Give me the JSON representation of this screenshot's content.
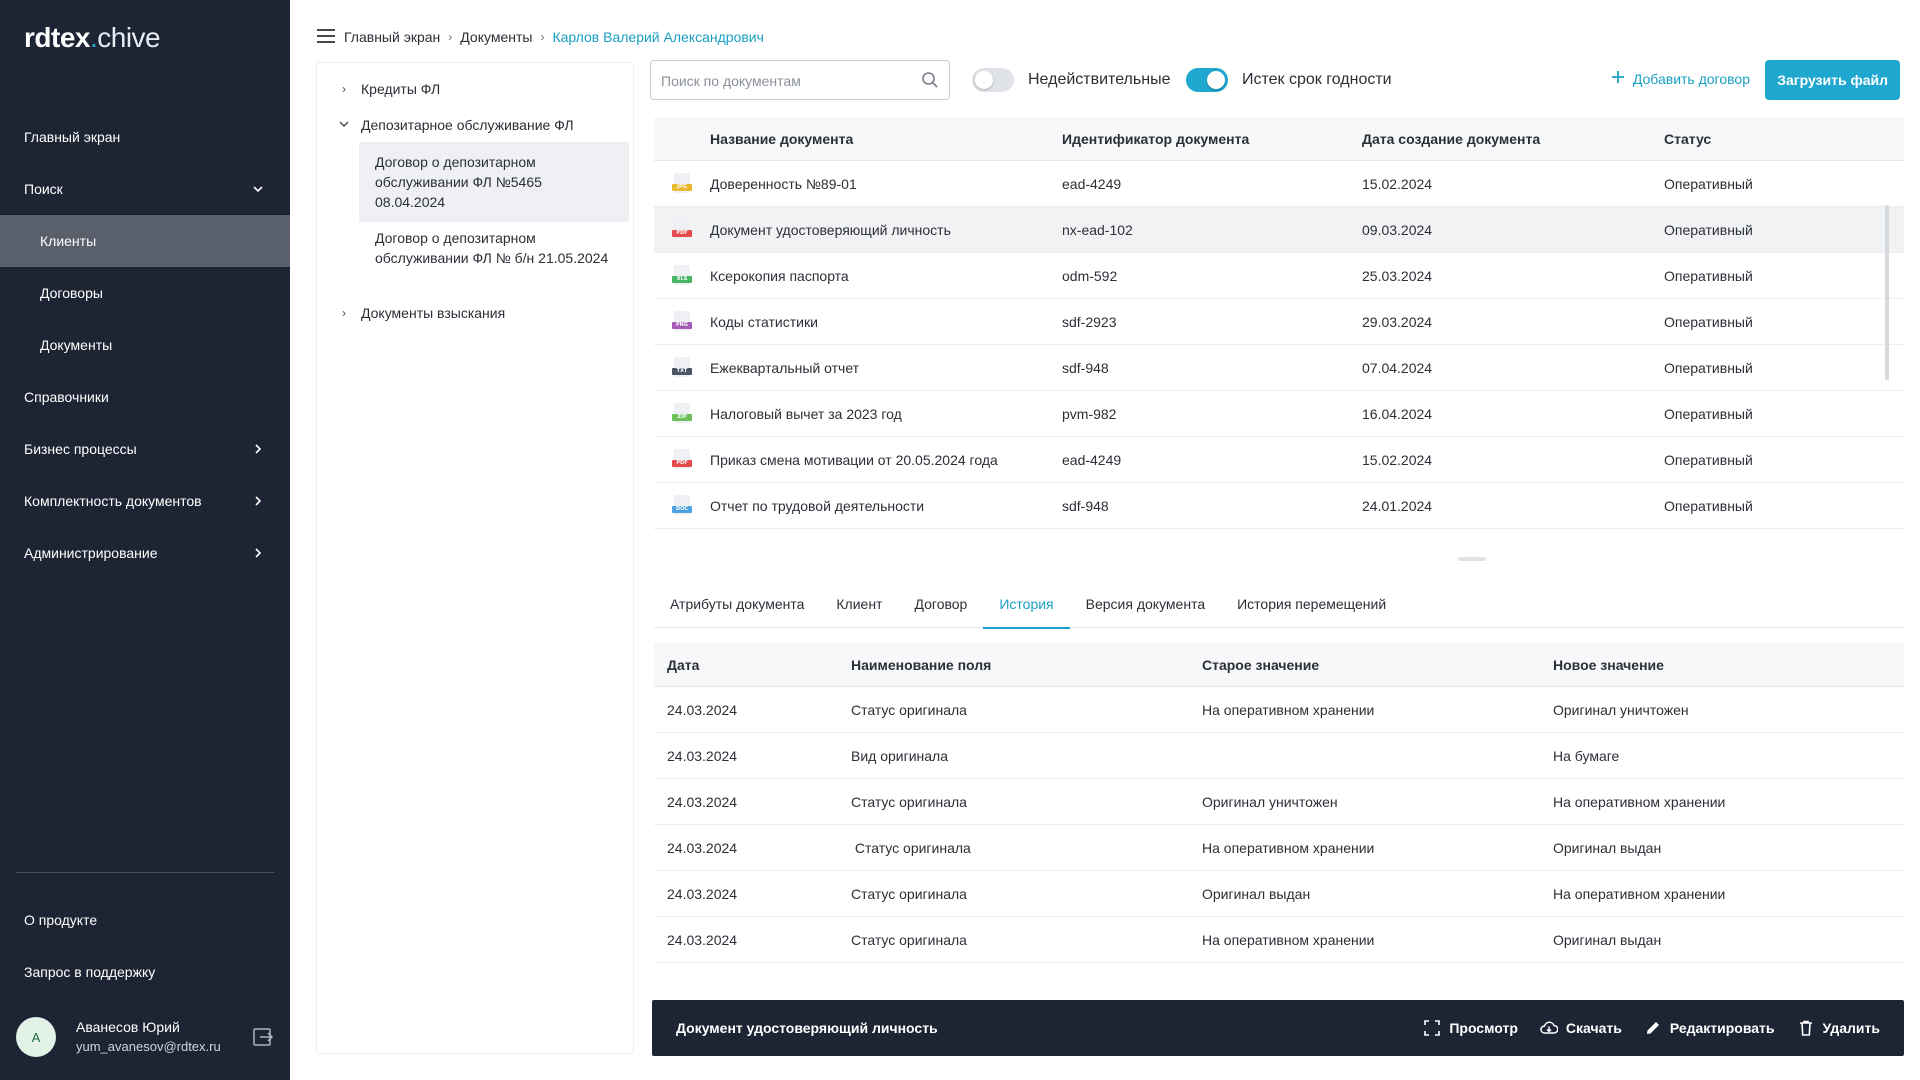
{
  "app": {
    "logo_bold": "rdtex",
    "logo_dot": ".",
    "logo_light": "chive"
  },
  "sidebar": {
    "items": [
      {
        "label": "Главный экран"
      },
      {
        "label": "Поиск"
      },
      {
        "label": "Клиенты"
      },
      {
        "label": "Договоры"
      },
      {
        "label": "Документы"
      },
      {
        "label": "Справочники"
      },
      {
        "label": "Бизнес процессы"
      },
      {
        "label": "Комплектность документов"
      },
      {
        "label": "Администрирование"
      }
    ],
    "bottom": [
      {
        "label": "О продукте"
      },
      {
        "label": "Запрос в поддержку"
      }
    ],
    "user": {
      "initial": "А",
      "name": "Аванесов Юрий",
      "email": "yum_avanesov@rdtex.ru"
    }
  },
  "breadcrumb": [
    "Главный экран",
    "Документы",
    "Карлов Валерий Александрович"
  ],
  "tree": {
    "groups": [
      {
        "label": "Кредиты ФЛ"
      },
      {
        "label": "Депозитарное обслуживание ФЛ"
      },
      {
        "label": "Документы взыскания"
      }
    ],
    "leaves": [
      {
        "label": "Договор о депозитарном обслуживании ФЛ №5465 08.04.2024"
      },
      {
        "label": "Договор о депозитарном обслуживании ФЛ № б/н 21.05.2024"
      }
    ]
  },
  "toolbar": {
    "search_placeholder": "Поиск по документам",
    "toggle_invalid": "Недействительные",
    "toggle_expired": "Истек срок годности",
    "add_contract": "Добавить договор",
    "upload_file": "Загрузить файл"
  },
  "documents": {
    "columns": [
      "Название документа",
      "Идентификатор документа",
      "Дата создание документа",
      "Статус"
    ],
    "rows": [
      {
        "type": "JPG",
        "color": "#e7b92e",
        "name": "Доверенность №89-01",
        "id": "ead-4249",
        "date": "15.02.2024",
        "status": "Оперативный"
      },
      {
        "type": "PDF",
        "color": "#e54b4b",
        "name": "Документ удостоверяющий личность",
        "id": "nx-ead-102",
        "date": "09.03.2024",
        "status": "Оперативный"
      },
      {
        "type": "XLS",
        "color": "#48b563",
        "name": "Ксерокопия паспорта",
        "id": "odm-592",
        "date": "25.03.2024",
        "status": "Оперативный"
      },
      {
        "type": "PNG",
        "color": "#a35bb5",
        "name": "Коды статистики",
        "id": "sdf-2923",
        "date": "29.03.2024",
        "status": "Оперативный"
      },
      {
        "type": "TXT",
        "color": "#4b5566",
        "name": "Ежеквартальный отчет",
        "id": "sdf-948",
        "date": "07.04.2024",
        "status": "Оперативный"
      },
      {
        "type": "ZIP",
        "color": "#6cc15a",
        "name": "Налоговый вычет за 2023 год",
        "id": "pvm-982",
        "date": "16.04.2024",
        "status": "Оперативный"
      },
      {
        "type": "PDF",
        "color": "#e54b4b",
        "name": "Приказ смена мотивации от 20.05.2024 года",
        "id": "ead-4249",
        "date": "15.02.2024",
        "status": "Оперативный"
      },
      {
        "type": "DOC",
        "color": "#4aa3e0",
        "name": "Отчет по трудовой деятельности",
        "id": "sdf-948",
        "date": "24.01.2024",
        "status": "Оперативный"
      }
    ]
  },
  "tabs": [
    "Атрибуты документа",
    "Клиент",
    "Договор",
    "История",
    "Версия документа",
    "История перемещений"
  ],
  "history": {
    "columns": [
      "Дата",
      "Наименование поля",
      "Старое значение",
      "Новое значение"
    ],
    "rows": [
      {
        "date": "24.03.2024",
        "field": "Статус оригинала",
        "old": "На оперативном хранении",
        "new": "Оригинал уничтожен"
      },
      {
        "date": "24.03.2024",
        "field": "Вид оригинала",
        "old": "",
        "new": "На бумаге"
      },
      {
        "date": "24.03.2024",
        "field": "Статус оригинала",
        "old": "Оригинал уничтожен",
        "new": "На оперативном хранении"
      },
      {
        "date": "24.03.2024",
        "field": " Статус оригинала",
        "old": "На оперативном хранении",
        "new": "Оригинал выдан"
      },
      {
        "date": "24.03.2024",
        "field": "Статус оригинала",
        "old": "Оригинал выдан",
        "new": "На оперативном хранении"
      },
      {
        "date": "24.03.2024",
        "field": "Статус оригинала",
        "old": "На оперативном хранении",
        "new": "Оригинал выдан"
      }
    ]
  },
  "action_bar": {
    "title": "Документ удостоверяющий личность",
    "view": "Просмотр",
    "download": "Скачать",
    "edit": "Редактировать",
    "delete": "Удалить"
  },
  "colors": {
    "accent": "#1ea7cf",
    "sidebar_bg": "#1d2433",
    "sidebar_active": "#5a606b"
  }
}
